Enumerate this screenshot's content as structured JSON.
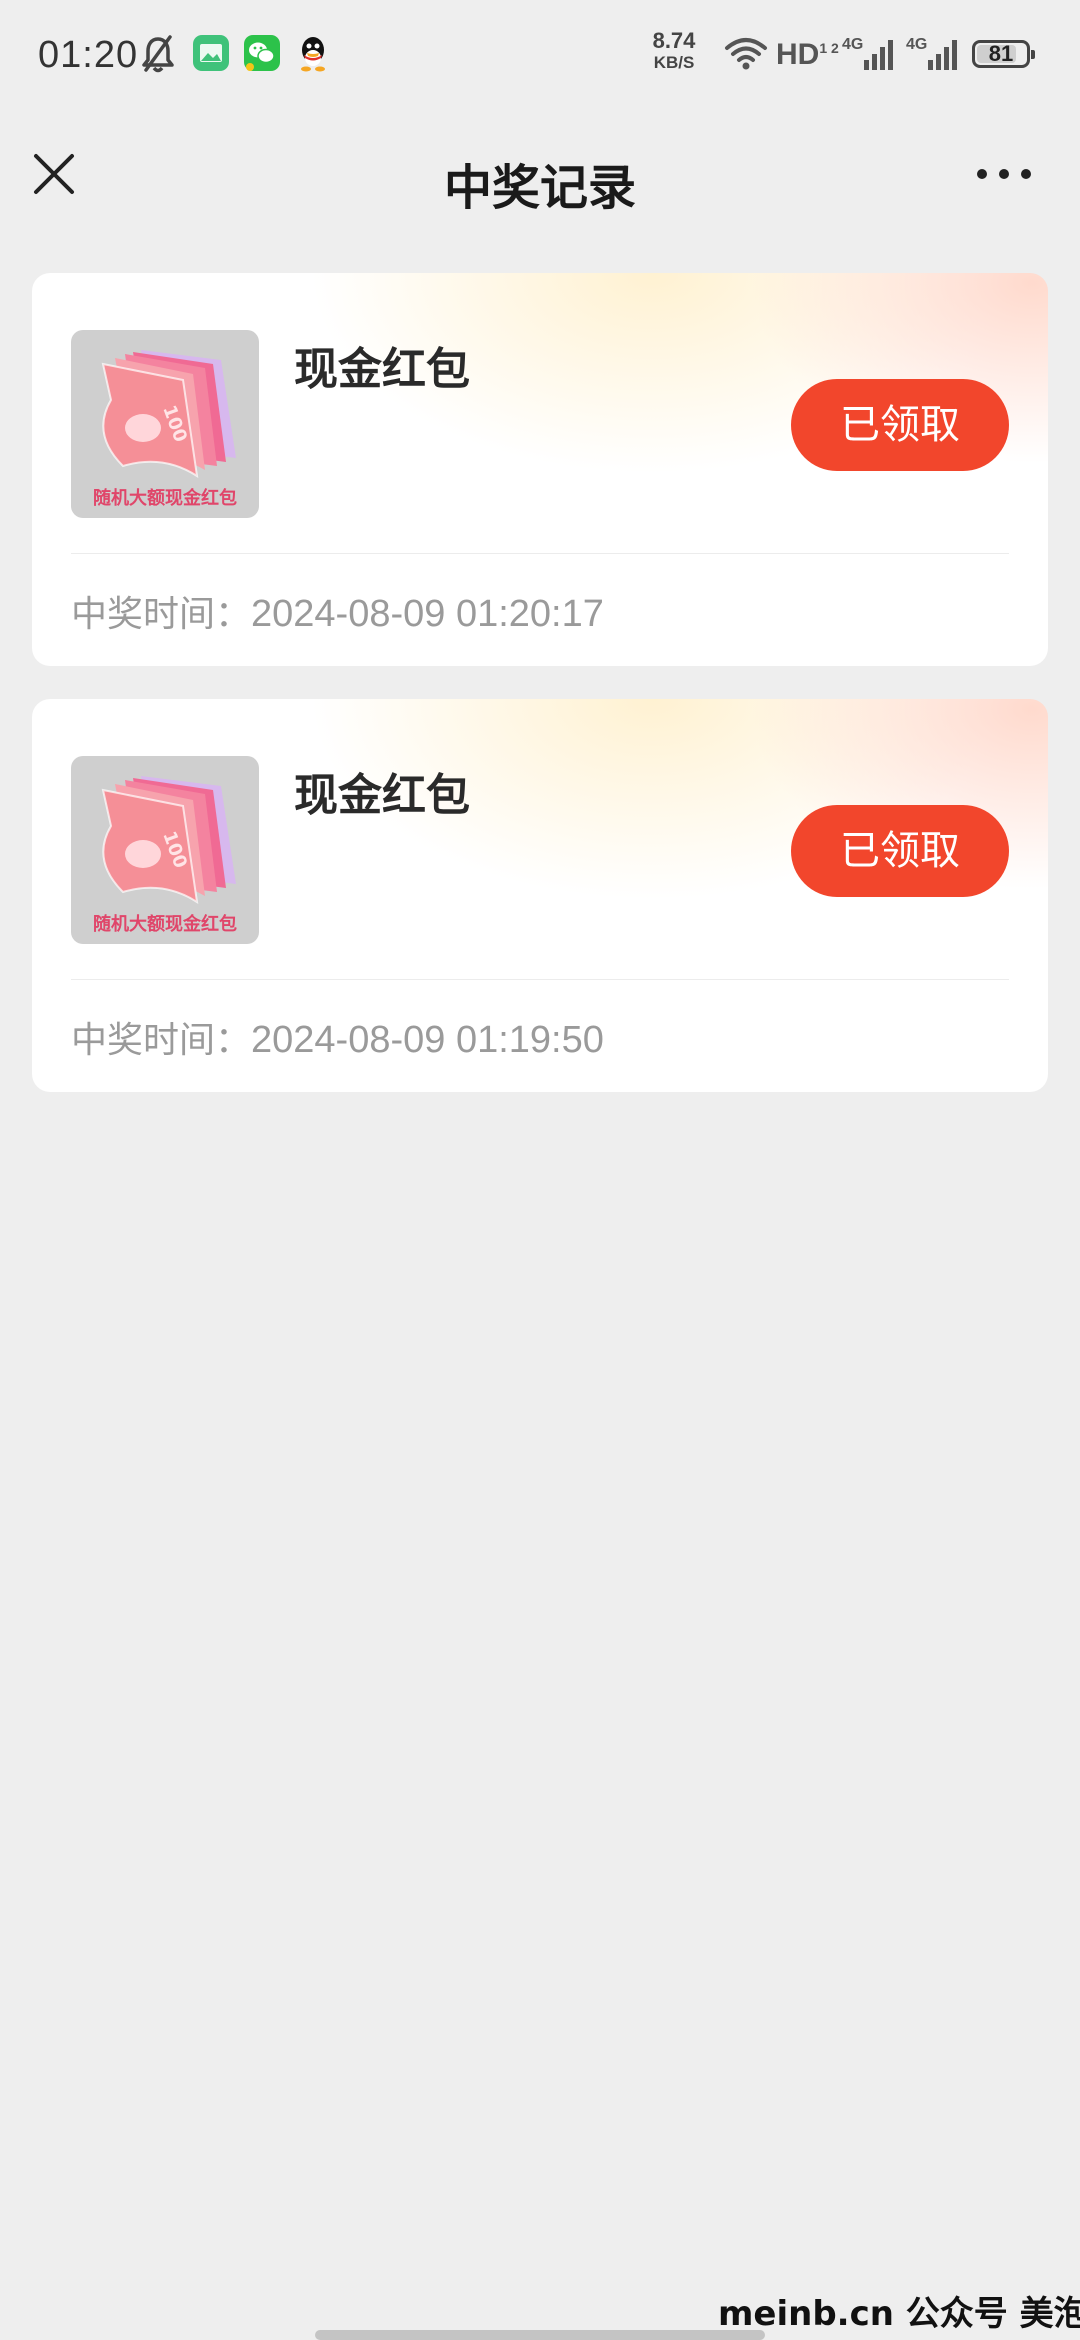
{
  "status_bar": {
    "time": "01:20",
    "net_speed_value": "8.74",
    "net_speed_unit": "KB/S",
    "hd_label": "HD",
    "hd_sub": "1 2",
    "signal_1_label": "4G",
    "signal_2_label": "4G",
    "battery_level": "81",
    "icons": [
      "silent-bell-icon",
      "gallery-app-icon",
      "wechat-app-icon",
      "qq-app-icon",
      "wifi-icon",
      "signal-icon",
      "battery-icon"
    ]
  },
  "nav": {
    "title": "中奖记录",
    "close_icon": "close-icon",
    "more_icon": "more-icon"
  },
  "prizes": [
    {
      "name": "现金红包",
      "thumb_caption": "随机大额现金红包",
      "button_label": "已领取",
      "time_label": "中奖时间：",
      "time_value": "2024-08-09 01:20:17"
    },
    {
      "name": "现金红包",
      "thumb_caption": "随机大额现金红包",
      "button_label": "已领取",
      "time_label": "中奖时间：",
      "time_value": "2024-08-09 01:19:50"
    }
  ],
  "watermark": "meinb.cn  公众号 美泡君",
  "colors": {
    "accent": "#f2462c",
    "background": "#eeeeee",
    "card": "#ffffff",
    "muted_text": "#9a9a9a"
  }
}
